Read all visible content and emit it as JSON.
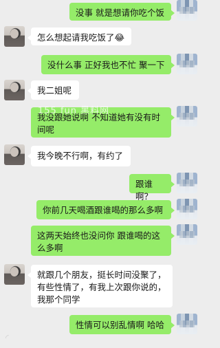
{
  "watermark": "155 fun 黑料网",
  "messages": [
    {
      "side": "me",
      "text": "没事 就是想请你吃个饭"
    },
    {
      "side": "her",
      "text": "怎么想起请我吃饭了😂"
    },
    {
      "side": "me",
      "text": "没什么事 正好我也不忙 聚一下"
    },
    {
      "side": "her",
      "text": "我二姐呢"
    },
    {
      "side": "me",
      "text": "我没跟她说啊 不知道她有没有时间呢"
    },
    {
      "side": "her",
      "text": "我今晚不行啊，有约了"
    },
    {
      "side": "me",
      "text": "跟谁啊？"
    },
    {
      "side": "me",
      "text": "你前几天喝酒跟谁喝的那么多啊"
    },
    {
      "side": "me",
      "text": "这两天始终也没问你 跟谁喝的这么多啊"
    },
    {
      "side": "her",
      "text": "就跟几个朋友，挺长时间没聚了，有些性情了，有我上次跟你说的，我那个同学"
    },
    {
      "side": "me",
      "text": "性情可以别乱情啊 哈哈"
    }
  ],
  "colors": {
    "me_bubble": "#95ec69",
    "her_bubble": "#ffffff",
    "background": "#ededed"
  }
}
